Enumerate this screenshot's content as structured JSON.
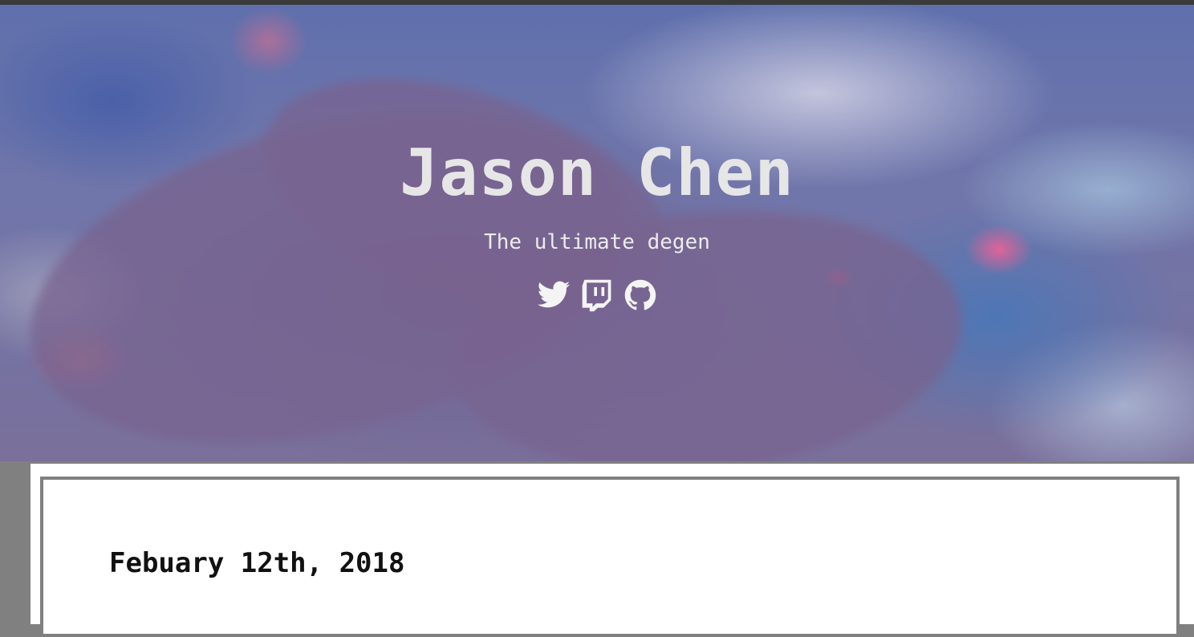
{
  "header": {
    "title": "Jason Chen",
    "subtitle": "The ultimate degen",
    "social_links": [
      {
        "icon": "twitter-icon"
      },
      {
        "icon": "twitch-icon"
      },
      {
        "icon": "github-icon"
      }
    ]
  },
  "post": {
    "date": "Febuary 12th, 2018"
  },
  "colors": {
    "title_text": "#e6e6e6",
    "card_border": "#808080",
    "page_background": "#808080"
  }
}
